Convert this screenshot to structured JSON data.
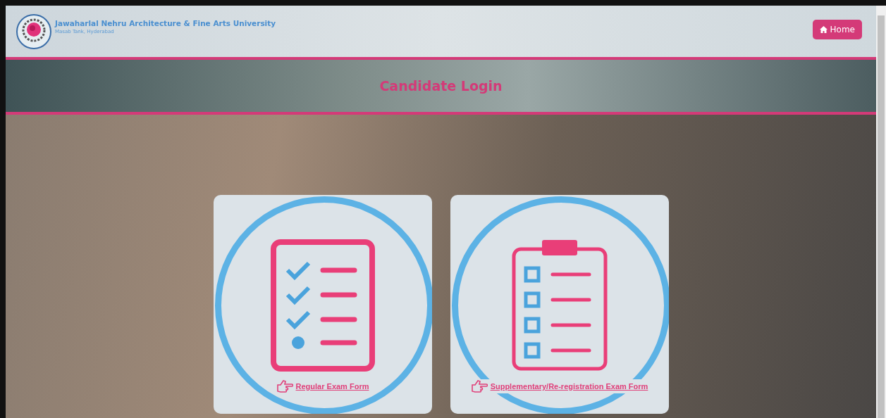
{
  "header": {
    "university_name": "Jawaharlal Nehru Architecture & Fine Arts University",
    "location": "Masab Tank, Hyderabad",
    "home_button": {
      "label": "Home"
    }
  },
  "banner": {
    "title": "Candidate Login"
  },
  "cards": [
    {
      "kind": "checklist",
      "link": "Regular Exam Form"
    },
    {
      "kind": "clipboard",
      "link": "Supplementary/Re-registration Exam Form"
    }
  ]
}
